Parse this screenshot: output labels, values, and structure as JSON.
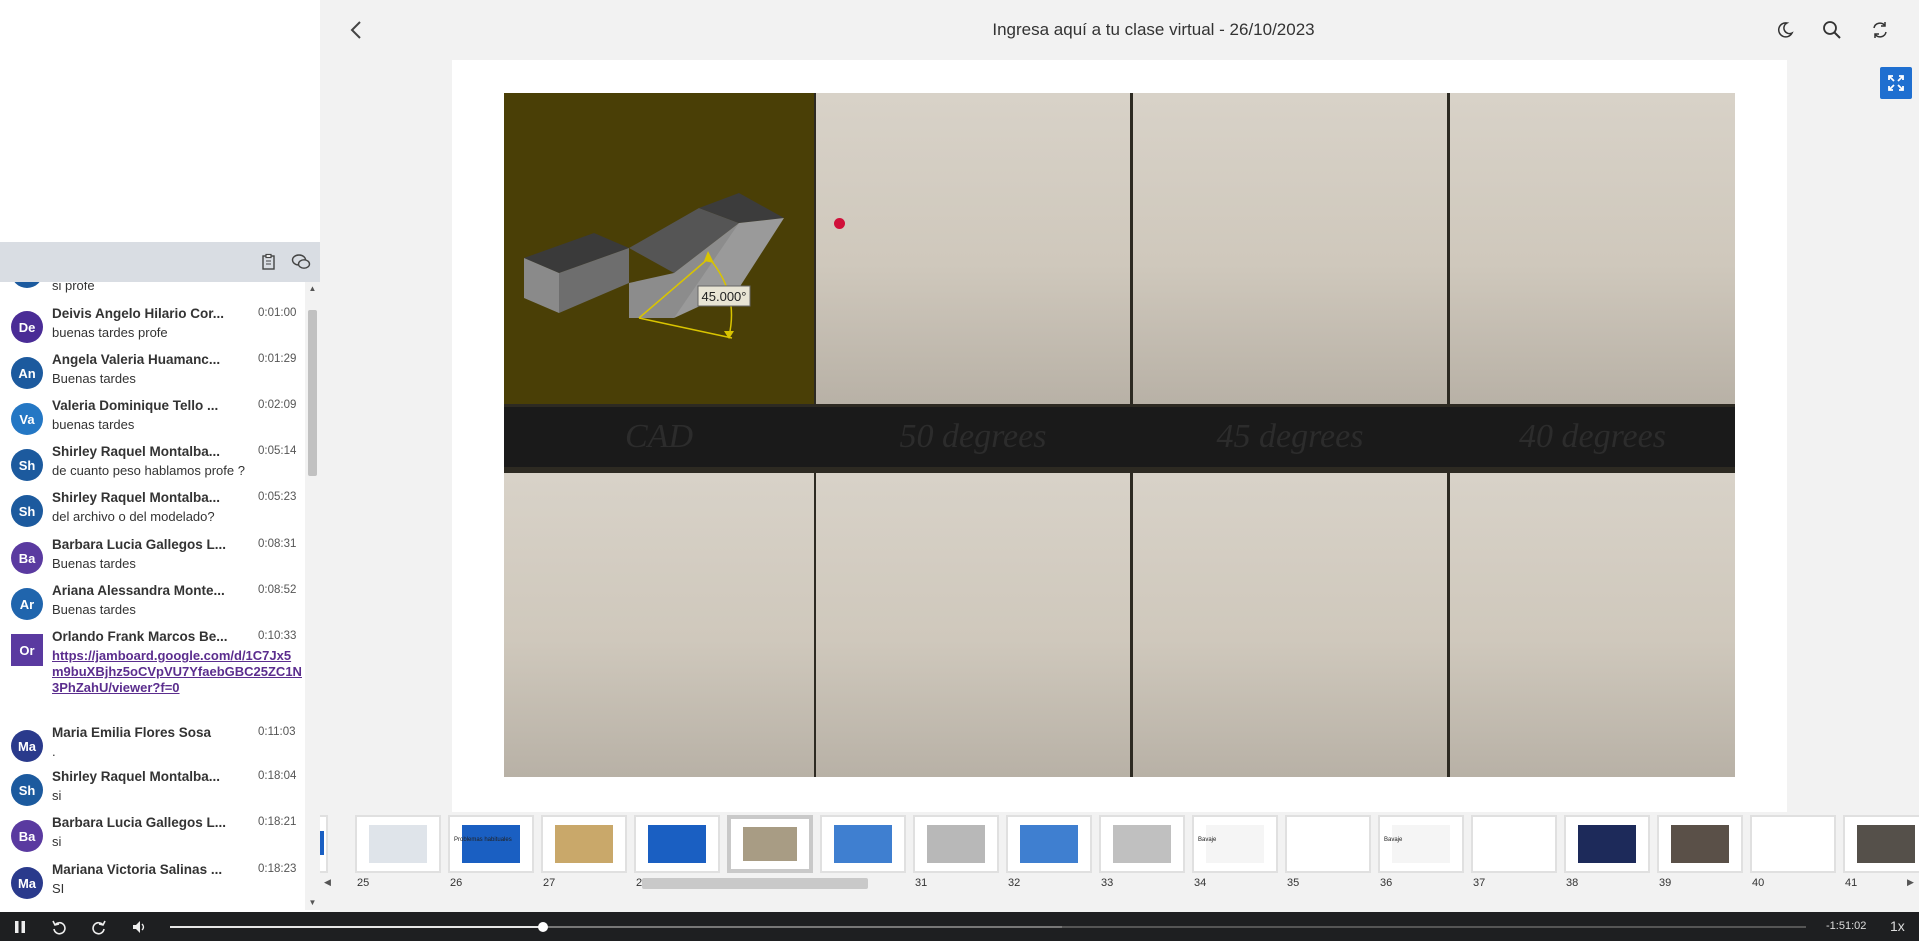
{
  "header": {
    "title": "Ingresa aquí a tu clase virtual - 26/10/2023"
  },
  "chat": {
    "partial_top_text": "si profe",
    "messages": [
      {
        "initials": "De",
        "color": "#4a2c96",
        "name": "Deivis Angelo Hilario Cor...",
        "time": "0:01:00",
        "text": "buenas tardes profe"
      },
      {
        "initials": "An",
        "color": "#1c5a9e",
        "name": "Angela Valeria Huamanc...",
        "time": "0:01:29",
        "text": "Buenas tardes"
      },
      {
        "initials": "Va",
        "color": "#2477c4",
        "name": "Valeria Dominique Tello ...",
        "time": "0:02:09",
        "text": "buenas tardes"
      },
      {
        "initials": "Sh",
        "color": "#1c5a9e",
        "name": "Shirley Raquel Montalba...",
        "time": "0:05:14",
        "text": "de cuanto peso hablamos profe ?"
      },
      {
        "initials": "Sh",
        "color": "#1c5a9e",
        "name": "Shirley Raquel Montalba...",
        "time": "0:05:23",
        "text": "del archivo o del modelado?"
      },
      {
        "initials": "Ba",
        "color": "#5a3aa0",
        "name": "Barbara Lucia Gallegos L...",
        "time": "0:08:31",
        "text": "Buenas tardes"
      },
      {
        "initials": "Ar",
        "color": "#2065ad",
        "name": "Ariana Alessandra Monte...",
        "time": "0:08:52",
        "text": "Buenas tardes"
      },
      {
        "initials": "Or",
        "color": "#5a3aa0",
        "name": "Orlando Frank Marcos Be...",
        "time": "0:10:33",
        "text": "https://jamboard.google.com/d/1C7Jx5m9buXBjhz5oCVpVU7YfaebGBC25ZC1N3PhZahU/viewer?f=0",
        "is_link": true
      },
      {
        "initials": "Ma",
        "color": "#2a3a8c",
        "name": "Maria Emilia Flores Sosa",
        "time": "0:11:03",
        "text": "."
      },
      {
        "initials": "Sh",
        "color": "#1c5a9e",
        "name": "Shirley Raquel Montalba...",
        "time": "0:18:04",
        "text": "si"
      },
      {
        "initials": "Ba",
        "color": "#5a3aa0",
        "name": "Barbara Lucia Gallegos L...",
        "time": "0:18:21",
        "text": "si"
      },
      {
        "initials": "Ma",
        "color": "#2a3a8c",
        "name": "Mariana Victoria Salinas ...",
        "time": "0:18:23",
        "text": "SI"
      }
    ]
  },
  "slide": {
    "cad_angle_label": "45.000°",
    "labels": [
      "CAD",
      "50 degrees",
      "45 degrees",
      "40 degrees"
    ]
  },
  "thumbnails": {
    "numbers": [
      "25",
      "26",
      "27",
      "28",
      "29",
      "30",
      "31",
      "32",
      "33",
      "34",
      "35",
      "36",
      "37",
      "38",
      "39",
      "40",
      "41"
    ],
    "active": "29",
    "tiny_texts": {
      "26": "Problemas habituales",
      "34": "Bavaje",
      "36": "Bavaje"
    }
  },
  "player": {
    "time_remaining": "-1:51:02",
    "speed": "1x",
    "progress_fraction": 0.228,
    "buffered_fraction": 0.545
  },
  "icons": [
    "back-icon",
    "moon-icon",
    "search-icon",
    "sync-icon",
    "expand-icon",
    "clipboard-icon",
    "chat-bubbles-icon",
    "pause-icon",
    "rewind-icon",
    "forward-icon",
    "volume-icon"
  ]
}
